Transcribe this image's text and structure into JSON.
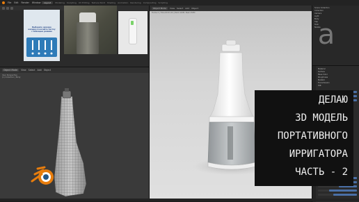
{
  "menu": [
    "File",
    "Edit",
    "Render",
    "Window",
    "Help"
  ],
  "workspace_tabs": [
    "Layout",
    "Modeling",
    "Sculpting",
    "UV Editing",
    "Texture Paint",
    "Shading",
    "Animation",
    "Rendering",
    "Compositing",
    "Scripting"
  ],
  "reference": {
    "phone_title": "Выберите нужную насадку и начните чистку с помощью режима"
  },
  "wire_viewport": {
    "header_items": [
      "Object Mode",
      "View",
      "Select",
      "Add",
      "Object"
    ],
    "info": [
      "User Perspective",
      "(1) Collection | Body"
    ]
  },
  "render_viewport": {
    "header_items": [
      "Object Mode",
      "View",
      "Select",
      "Add",
      "Object"
    ],
    "info": "Frame:1 | Time:00:01.44 | Mem:143M, Peak:153M"
  },
  "outliner": {
    "items": [
      "Scene Collection",
      "Collection",
      "Camera",
      "Light",
      "Body",
      "Cap",
      "Tank",
      "Nozzle"
    ]
  },
  "properties": {
    "items": [
      "Material",
      "Surface",
      "Base Color",
      "Roughness",
      "Metallic",
      "Transmission",
      "IOR"
    ]
  },
  "title_lines": [
    "ДЕЛАЮ",
    "3D МОДЕЛЬ",
    "ПОРТАТИВНОГО",
    "ИРРИГАТОРА",
    "ЧАСТЬ - 2"
  ],
  "colors": {
    "accent": "#4a6fa6",
    "blender_orange": "#e87d0d",
    "blender_blue": "#265787"
  }
}
